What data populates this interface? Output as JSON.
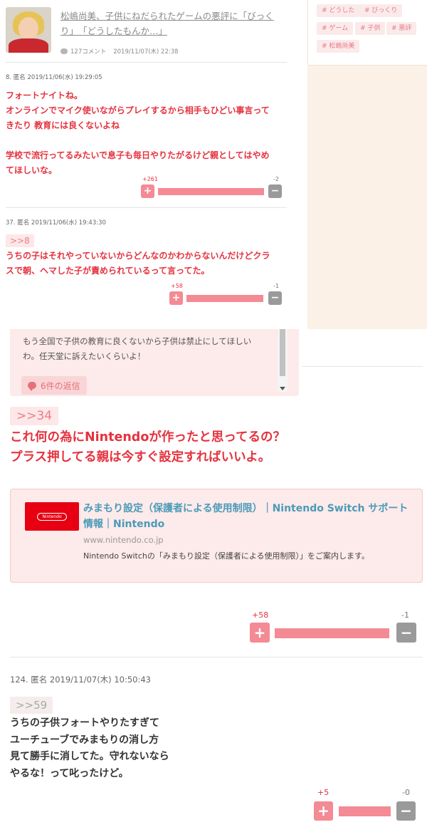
{
  "article": {
    "title_line1": "松嶋尚美、子供にねだられたゲームの悪評に「びっく",
    "title_line2": "り」　「どうしたもんか…」",
    "comment_count": "127コメント",
    "date": "2019/11/07(木) 22:38"
  },
  "tags": [
    "どうした",
    "びっくり",
    "ゲーム",
    "子供",
    "悪評",
    "松嶋尚美"
  ],
  "tag_prefix": "#",
  "comment8": {
    "header": "8. 匿名 2019/11/06(水) 19:29:05",
    "lines": [
      "フォートナイトね。",
      "オンラインでマイク使いながらプレイするから相手もひどい事言って",
      "きたり 教育には良くないよね",
      "",
      "学校で流行ってるみたいで息子も毎日やりたがるけど親としてはやめ",
      "てほしいな。"
    ],
    "plus": "+261",
    "minus": "-2",
    "plus_ratio": 0.992
  },
  "comment37": {
    "header": "37. 匿名 2019/11/06(水) 19:43:30",
    "anchor": ">>8",
    "lines": [
      "うちの子はそれやっていないからどんなのかわからないんだけどクラ",
      "スで朝、ヘマした子が責められているって言ってた。"
    ],
    "plus": "+58",
    "minus": "-1",
    "plus_ratio": 0.983
  },
  "reply_box": {
    "lines": [
      "もう全国で子供の教育に良くないから子供は禁止にしてほしい",
      "わ。任天堂に訴えたいくらいよ！"
    ],
    "reply_link": "6件の返信"
  },
  "comment_big": {
    "anchor": ">>34",
    "lines": [
      "これ何の為にNintendoが作ったと思ってるの？",
      "プラス押してる親は今すぐ設定すればいいよ。"
    ],
    "link_card": {
      "logo_text": "Nintendo",
      "title": "みまもり設定（保護者による使用制限）｜Nintendo Switch サポート情報｜Nintendo",
      "domain": "www.nintendo.co.jp",
      "description": "Nintendo Switchの「みまもり設定（保護者による使用制限）」をご案内します。"
    },
    "plus": "+58",
    "minus": "-1",
    "plus_ratio": 0.983
  },
  "comment124": {
    "header": "124. 匿名 2019/11/07(木) 10:50:43",
    "anchor": ">>59",
    "lines": [
      "うちの子供フォートやりたすぎて",
      "ユーチューブでみまもりの消し方",
      "見て勝手に消してた。守れないなら",
      "やるな！って叱ったけど。"
    ],
    "plus": "+5",
    "minus": "-0",
    "plus_ratio": 1.0
  },
  "vote_labels": {
    "plus": "+",
    "minus": "−"
  },
  "colors": {
    "accent_red": "#e5323e",
    "pink_button": "#f48a94",
    "gray_button": "#9a9a9a",
    "link_blue": "#4a9bb8",
    "nintendo_red": "#e60012"
  }
}
